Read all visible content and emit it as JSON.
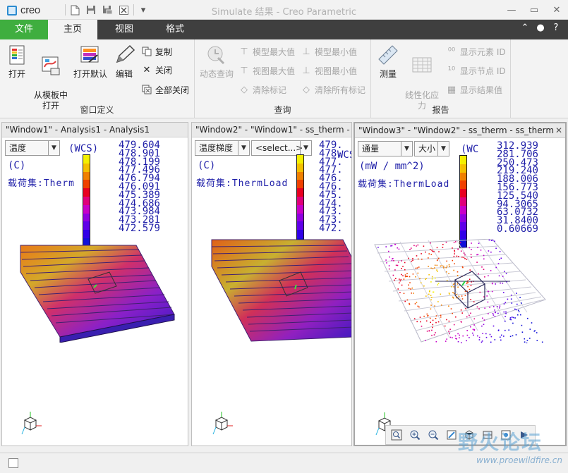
{
  "app": {
    "logo_text": "creo",
    "title": "Simulate 结果 - Creo Parametric"
  },
  "tabs": {
    "file": "文件",
    "home": "主页",
    "view": "视图",
    "format": "格式"
  },
  "ribbon": {
    "window_group": {
      "label": "窗口定义",
      "open": "打开",
      "from_template": "从模板中\n打开",
      "open_default": "打开默认",
      "edit": "编辑",
      "copy": "复制",
      "close": "关闭",
      "close_all": "全部关闭"
    },
    "query_group": {
      "label": "查询",
      "dynamic_query": "动态查询",
      "model_max": "模型最大值",
      "model_min": "模型最小值",
      "view_max": "视图最大值",
      "view_min": "视图最小值",
      "clear_tags": "清除标记",
      "clear_all_tags": "清除所有标记"
    },
    "report_group": {
      "label": "报告",
      "measure": "测量",
      "linearized_stress": "线性化应\n力",
      "show_element_id": "显示元素 ID",
      "show_node_id": "显示节点 ID",
      "show_result_values": "显示结果值"
    }
  },
  "windows": [
    {
      "title": "\"Window1\" - Analysis1 - Analysis1",
      "combo1": "温度",
      "unit_wcs": "(WCS)",
      "unit": "(C)",
      "loadset": "载荷集:Therm",
      "legend_values": [
        "479.604",
        "478.901",
        "478.199",
        "477.496",
        "476.794",
        "476.091",
        "475.389",
        "474.686",
        "473.984",
        "473.281",
        "472.579"
      ]
    },
    {
      "title": "\"Window2\" - \"Window1\" - ss_therm - s",
      "combo1": "温度梯度",
      "combo2": "<select...>",
      "unit_wcs": "WCS",
      "unit": "(C)",
      "loadset": "载荷集:ThermLoad",
      "legend_values": [
        "479.",
        "478.",
        "477.",
        "477.",
        "476.",
        "476.",
        "475.",
        "474.",
        "473.",
        "473.",
        "472."
      ]
    },
    {
      "title": "\"Window3\" - \"Window2\" - ss_therm - ss_therm",
      "combo1": "通量",
      "combo2": "大小",
      "unit_wcs": "(WC",
      "unit": "(mW / mm^2)",
      "loadset": "载荷集:ThermLoad",
      "legend_values": [
        "312.939",
        "281.706",
        "250.473",
        "219.240",
        "188.006",
        "156.773",
        "125.540",
        "94.3065",
        "63.0732",
        "31.8400",
        "0.60669"
      ]
    }
  ],
  "legend_colors": [
    "#f4f000",
    "#f4c000",
    "#f08000",
    "#f04000",
    "#e80020",
    "#e0007a",
    "#c800c8",
    "#9000e0",
    "#6000e8",
    "#3000e8",
    "#1010d8"
  ],
  "watermark": {
    "text": "野火论坛",
    "url": "www.proewildfire.cn"
  }
}
